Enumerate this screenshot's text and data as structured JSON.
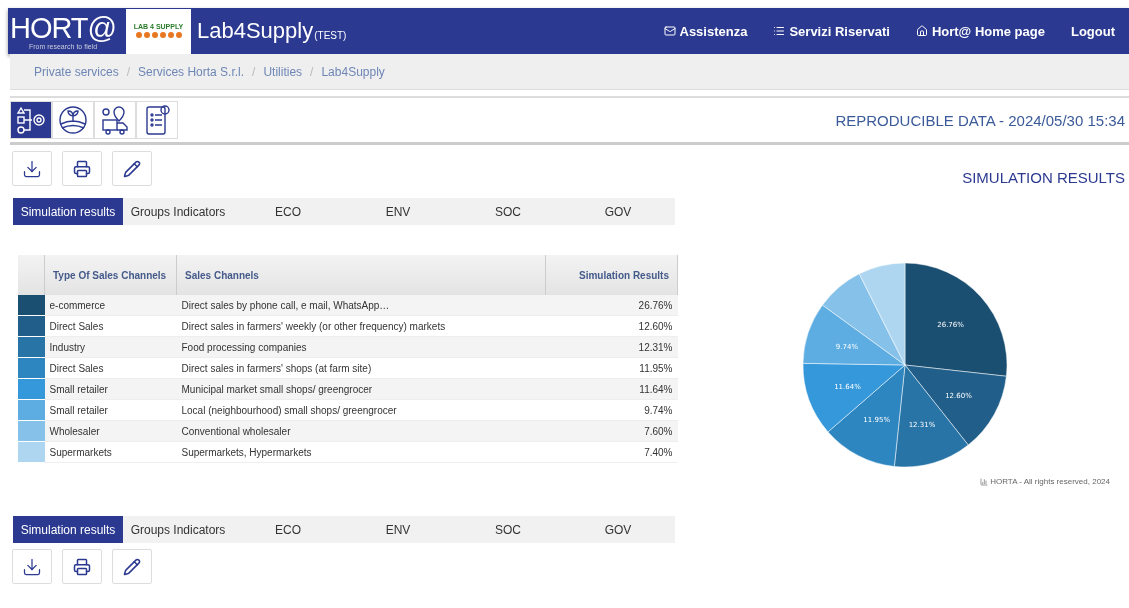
{
  "header": {
    "brand": "HORT@",
    "brand_tagline": "From research to field",
    "logo_text": "LAB 4 SUPPLY",
    "app_title": "Lab4Supply",
    "app_suffix": "(TEST)",
    "nav": [
      {
        "kind": "mail",
        "label": "Assistenza"
      },
      {
        "kind": "list",
        "label": "Servizi Riservati"
      },
      {
        "kind": "home",
        "label": "Hort@ Home page"
      },
      {
        "kind": "plain",
        "label": "Logout"
      }
    ]
  },
  "breadcrumb": {
    "separator": "/",
    "items": [
      "Private services",
      "Services Horta S.r.l.",
      "Utilities",
      "Lab4Supply"
    ]
  },
  "modules": [
    {
      "kind": "process",
      "selected": true
    },
    {
      "kind": "field",
      "selected": false
    },
    {
      "kind": "logistics",
      "selected": false
    },
    {
      "kind": "checklist",
      "selected": false
    }
  ],
  "reproducible": "REPRODUCIBLE DATA - 2024/05/30 15:34",
  "actions": [
    {
      "kind": "download"
    },
    {
      "kind": "print"
    },
    {
      "kind": "edit"
    }
  ],
  "section_title": "SIMULATION RESULTS",
  "tabs": [
    {
      "label": "Simulation results",
      "selected": true
    },
    {
      "label": "Groups Indicators",
      "selected": false
    },
    {
      "label": "ECO",
      "selected": false
    },
    {
      "label": "ENV",
      "selected": false
    },
    {
      "label": "SOC",
      "selected": false
    },
    {
      "label": "GOV",
      "selected": false
    }
  ],
  "table": {
    "columns": [
      "Type Of Sales Channels",
      "Sales Channels",
      "Simulation Results"
    ],
    "rows": [
      {
        "color": "#1b4f72",
        "type": "e-commerce",
        "channel": "Direct sales by phone call, e mail, WhatsApp…",
        "result": "26.76%"
      },
      {
        "color": "#215f8a",
        "type": "Direct Sales",
        "channel": "Direct sales in farmers' weekly (or other frequency) markets",
        "result": "12.60%"
      },
      {
        "color": "#2874a6",
        "type": "Industry",
        "channel": "Food processing companies",
        "result": "12.31%"
      },
      {
        "color": "#2e86c1",
        "type": "Direct Sales",
        "channel": "Direct sales in farmers' shops (at farm site)",
        "result": "11.95%"
      },
      {
        "color": "#3498db",
        "type": "Small retailer",
        "channel": "Municipal market small shops/ greengrocer",
        "result": "11.64%"
      },
      {
        "color": "#5dade2",
        "type": "Small retailer",
        "channel": "Local (neighbourhood) small shops/ greengrocer",
        "result": "9.74%"
      },
      {
        "color": "#85c1e9",
        "type": "Wholesaler",
        "channel": "Conventional wholesaler",
        "result": "7.60%"
      },
      {
        "color": "#aed6f1",
        "type": "Supermarkets",
        "channel": "Supermarkets, Hypermarkets",
        "result": "7.40%"
      }
    ]
  },
  "chart_data": {
    "type": "pie",
    "values": [
      26.76,
      12.6,
      12.31,
      11.95,
      11.64,
      9.74,
      7.6,
      7.4
    ],
    "value_labels": [
      "26.76%",
      "12.60%",
      "12.31%",
      "11.95%",
      "11.64%",
      "9.74%",
      null,
      null
    ]
  },
  "chart_credit": "HORTA - All rights reserved, 2024",
  "bottom_tabs": [
    {
      "label": "Simulation results",
      "selected": true
    },
    {
      "label": "Groups Indicators",
      "selected": false
    },
    {
      "label": "ECO",
      "selected": false
    },
    {
      "label": "ENV",
      "selected": false
    },
    {
      "label": "SOC",
      "selected": false
    },
    {
      "label": "GOV",
      "selected": false
    }
  ],
  "bottom_actions": [
    {
      "kind": "download"
    },
    {
      "kind": "print"
    },
    {
      "kind": "edit"
    }
  ]
}
